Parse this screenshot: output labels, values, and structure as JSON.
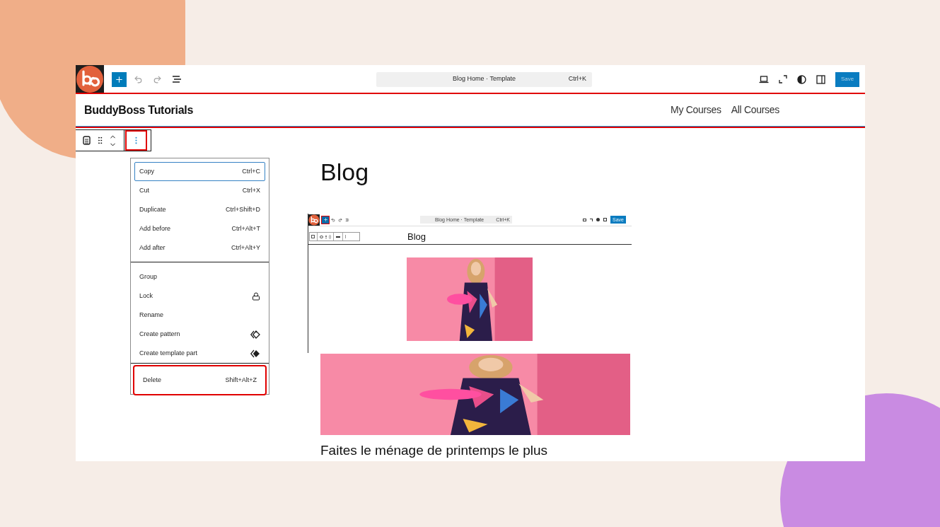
{
  "editor_bar": {
    "command": "Blog Home · Template",
    "shortcut": "Ctrl+K",
    "save": "Save"
  },
  "header": {
    "site_title": "BuddyBoss Tutorials",
    "nav": [
      "My Courses",
      "All Courses"
    ],
    "annotated": true
  },
  "block_toolbar": {
    "options_annotated": true
  },
  "menu": {
    "groups": [
      [
        {
          "label": "Copy",
          "kind": "shortcut",
          "shortcut": "Ctrl+C",
          "focused": true,
          "annotated": false
        },
        {
          "label": "Cut",
          "kind": "shortcut",
          "shortcut": "Ctrl+X",
          "focused": false,
          "annotated": false
        },
        {
          "label": "Duplicate",
          "kind": "shortcut",
          "shortcut": "Ctrl+Shift+D",
          "focused": false,
          "annotated": false
        },
        {
          "label": "Add before",
          "kind": "shortcut",
          "shortcut": "Ctrl+Alt+T",
          "focused": false,
          "annotated": false
        },
        {
          "label": "Add after",
          "kind": "shortcut",
          "shortcut": "Ctrl+Alt+Y",
          "focused": false,
          "annotated": false
        }
      ],
      [
        {
          "label": "Group",
          "kind": "plain",
          "focused": false,
          "annotated": false
        },
        {
          "label": "Lock",
          "kind": "lock",
          "focused": false,
          "annotated": false
        },
        {
          "label": "Rename",
          "kind": "plain",
          "focused": false,
          "annotated": false
        },
        {
          "label": "Create pattern",
          "kind": "pattern",
          "focused": false,
          "annotated": false
        },
        {
          "label": "Create template part",
          "kind": "part",
          "focused": false,
          "annotated": false
        }
      ],
      [
        {
          "label": "Delete",
          "kind": "shortcut",
          "shortcut": "Shift+Alt+Z",
          "focused": false,
          "annotated": true
        }
      ]
    ]
  },
  "content": {
    "title": "Blog",
    "embedded": {
      "command": "Blog Home · Template",
      "shortcut": "Ctrl+K",
      "save": "Save",
      "title": "Blog"
    },
    "excerpt": "Faites le ménage de printemps le plus"
  }
}
